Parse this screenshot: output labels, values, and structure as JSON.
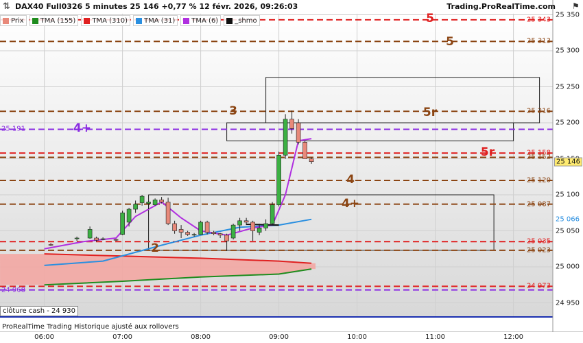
{
  "header": {
    "instrument": "DAX40 Full0326 5 minutes 25 146 +0,77 % 12 févr. 2026, 09:26:03",
    "brand": "Trading.ProRealTime.com"
  },
  "legend": [
    {
      "label": "Prix",
      "color": "#e8897a"
    },
    {
      "label": "TMA (155)",
      "color": "#1e8c1e"
    },
    {
      "label": "TMA (310)",
      "color": "#e02020"
    },
    {
      "label": "TMA (31)",
      "color": "#2a8fe0"
    },
    {
      "label": "TMA (6)",
      "color": "#b030e0"
    },
    {
      "label": "_shmo",
      "color": "#111111"
    }
  ],
  "footer": {
    "cash_close": "clôture cash -  24 930",
    "notice": "ProRealTime Trading  Historique ajusté aux rollovers"
  },
  "chart_data": {
    "type": "candlestick",
    "title": "DAX40 Full0326 5 minutes 25 146 +0,77 % 12 févr. 2026, 09:26:03",
    "x_ticks": [
      "06:00",
      "07:00",
      "08:00",
      "09:00",
      "10:00",
      "11:00",
      "12:00"
    ],
    "y_ticks": [
      "24 950",
      "25 000",
      "25 050",
      "25 100",
      "25 150",
      "25 200",
      "25 250",
      "25 300",
      "25 350"
    ],
    "ylim": [
      24915,
      25355
    ],
    "current_price": "25 146",
    "price_tags": [
      {
        "label": "25 066",
        "value": 25066,
        "color": "#2a8fe0"
      }
    ],
    "levels": [
      {
        "value": 25343,
        "label": "25 343",
        "color": "#e02020"
      },
      {
        "value": 25313,
        "label": "25 313",
        "color": "#8b4513"
      },
      {
        "value": 25216,
        "label": "25 216",
        "color": "#8b4513"
      },
      {
        "value": 25191,
        "label": "25 191",
        "color": "#8a2be2",
        "left": true
      },
      {
        "value": 25158,
        "label": "25 158",
        "color": "#e02020"
      },
      {
        "value": 25152,
        "label": "25 152",
        "color": "#8b4513"
      },
      {
        "value": 25120,
        "label": "25 120",
        "color": "#8b4513"
      },
      {
        "value": 25087,
        "label": "25 087",
        "color": "#8b4513"
      },
      {
        "value": 25035,
        "label": "25 035",
        "color": "#e02020"
      },
      {
        "value": 25023,
        "label": "25 023",
        "color": "#8b4513"
      },
      {
        "value": 24968,
        "label": "24 968",
        "color": "#8a2be2",
        "left": true
      },
      {
        "value": 24973,
        "label": "24 973",
        "color": "#e02020"
      }
    ],
    "annotations": [
      {
        "text": "5",
        "color": "#e02020"
      },
      {
        "text": "5",
        "color": "#8b4513"
      },
      {
        "text": "3",
        "color": "#8b4513"
      },
      {
        "text": "5r",
        "color": "#8b4513"
      },
      {
        "text": "4+",
        "color": "#8a2be2"
      },
      {
        "text": "5r",
        "color": "#e02020"
      },
      {
        "text": "4",
        "color": "#8b4513"
      },
      {
        "text": "4+",
        "color": "#8b4513"
      },
      {
        "text": "2",
        "color": "#8b4513"
      }
    ],
    "candles": [
      {
        "t": "06:05",
        "o": 25031,
        "h": 25033,
        "l": 25029,
        "c": 25030
      },
      {
        "t": "06:25",
        "o": 25039,
        "h": 25042,
        "l": 25036,
        "c": 25040
      },
      {
        "t": "06:35",
        "o": 25040,
        "h": 25056,
        "l": 25039,
        "c": 25052
      },
      {
        "t": "06:40",
        "o": 25040,
        "h": 25042,
        "l": 25035,
        "c": 25037
      },
      {
        "t": "06:45",
        "o": 25039,
        "h": 25041,
        "l": 25037,
        "c": 25039
      },
      {
        "t": "06:55",
        "o": 25038,
        "h": 25039,
        "l": 25036,
        "c": 25037
      },
      {
        "t": "07:00",
        "o": 25045,
        "h": 25078,
        "l": 25044,
        "c": 25075
      },
      {
        "t": "07:05",
        "o": 25062,
        "h": 25082,
        "l": 25056,
        "c": 25080
      },
      {
        "t": "07:10",
        "o": 25080,
        "h": 25092,
        "l": 25075,
        "c": 25087
      },
      {
        "t": "07:15",
        "o": 25089,
        "h": 25100,
        "l": 25085,
        "c": 25098
      },
      {
        "t": "07:20",
        "o": 25088,
        "h": 25092,
        "l": 25080,
        "c": 25090
      },
      {
        "t": "07:25",
        "o": 25086,
        "h": 25095,
        "l": 25085,
        "c": 25093
      },
      {
        "t": "07:30",
        "o": 25093,
        "h": 25097,
        "l": 25088,
        "c": 25090
      },
      {
        "t": "07:35",
        "o": 25090,
        "h": 25096,
        "l": 25058,
        "c": 25060
      },
      {
        "t": "07:40",
        "o": 25060,
        "h": 25064,
        "l": 25046,
        "c": 25050
      },
      {
        "t": "07:45",
        "o": 25052,
        "h": 25058,
        "l": 25040,
        "c": 25048
      },
      {
        "t": "07:50",
        "o": 25048,
        "h": 25050,
        "l": 25043,
        "c": 25045
      },
      {
        "t": "07:55",
        "o": 25045,
        "h": 25047,
        "l": 25042,
        "c": 25045
      },
      {
        "t": "08:00",
        "o": 25045,
        "h": 25064,
        "l": 25045,
        "c": 25062
      },
      {
        "t": "08:05",
        "o": 25062,
        "h": 25064,
        "l": 25045,
        "c": 25048
      },
      {
        "t": "08:10",
        "o": 25048,
        "h": 25050,
        "l": 25044,
        "c": 25046
      },
      {
        "t": "08:15",
        "o": 25046,
        "h": 25047,
        "l": 25040,
        "c": 25044
      },
      {
        "t": "08:20",
        "o": 25044,
        "h": 25046,
        "l": 25022,
        "c": 25036
      },
      {
        "t": "08:25",
        "o": 25040,
        "h": 25060,
        "l": 25038,
        "c": 25058
      },
      {
        "t": "08:30",
        "o": 25058,
        "h": 25068,
        "l": 25050,
        "c": 25064
      },
      {
        "t": "08:35",
        "o": 25064,
        "h": 25068,
        "l": 25058,
        "c": 25062
      },
      {
        "t": "08:40",
        "o": 25062,
        "h": 25064,
        "l": 25036,
        "c": 25050
      },
      {
        "t": "08:45",
        "o": 25048,
        "h": 25060,
        "l": 25044,
        "c": 25054
      },
      {
        "t": "08:50",
        "o": 25054,
        "h": 25066,
        "l": 25050,
        "c": 25060
      },
      {
        "t": "08:55",
        "o": 25060,
        "h": 25090,
        "l": 25058,
        "c": 25086
      },
      {
        "t": "09:00",
        "o": 25086,
        "h": 25160,
        "l": 25084,
        "c": 25155
      },
      {
        "t": "09:05",
        "o": 25155,
        "h": 25212,
        "l": 25150,
        "c": 25205
      },
      {
        "t": "09:10",
        "o": 25205,
        "h": 25217,
        "l": 25185,
        "c": 25192
      },
      {
        "t": "09:15",
        "o": 25200,
        "h": 25205,
        "l": 25170,
        "c": 25173
      },
      {
        "t": "09:20",
        "o": 25173,
        "h": 25175,
        "l": 25150,
        "c": 25150
      },
      {
        "t": "09:25",
        "o": 25150,
        "h": 25152,
        "l": 25143,
        "c": 25146
      }
    ],
    "boxes": [
      {
        "x_from": "08:50",
        "x_to": "12:20",
        "y_from": 25200,
        "y_to": 25263
      },
      {
        "x_from": "08:20",
        "x_to": "12:00",
        "y_from": 25175,
        "y_to": 25200
      },
      {
        "x_from": "07:20",
        "x_to": "11:45",
        "y_from": 25023,
        "y_to": 25100
      }
    ],
    "series": [
      {
        "name": "TMA (155)",
        "color": "#1e8c1e",
        "points": [
          [
            "06:00",
            24975
          ],
          [
            "07:00",
            24980
          ],
          [
            "08:00",
            24986
          ],
          [
            "09:00",
            24990
          ],
          [
            "09:25",
            24997
          ]
        ]
      },
      {
        "name": "TMA (310)",
        "color": "#e02020",
        "points": [
          [
            "06:00",
            25018
          ],
          [
            "07:00",
            25015
          ],
          [
            "08:00",
            25012
          ],
          [
            "09:00",
            25008
          ],
          [
            "09:25",
            25005
          ]
        ]
      },
      {
        "name": "TMA (31)",
        "color": "#2a8fe0",
        "points": [
          [
            "06:00",
            25002
          ],
          [
            "06:45",
            25008
          ],
          [
            "07:30",
            25030
          ],
          [
            "08:00",
            25044
          ],
          [
            "08:30",
            25055
          ],
          [
            "09:00",
            25058
          ],
          [
            "09:25",
            25066
          ]
        ]
      },
      {
        "name": "TMA (6)",
        "color": "#b030e0",
        "points": [
          [
            "06:00",
            25025
          ],
          [
            "06:30",
            25035
          ],
          [
            "06:55",
            25040
          ],
          [
            "07:10",
            25070
          ],
          [
            "07:30",
            25090
          ],
          [
            "07:45",
            25068
          ],
          [
            "08:00",
            25050
          ],
          [
            "08:20",
            25044
          ],
          [
            "08:40",
            25054
          ],
          [
            "08:55",
            25058
          ],
          [
            "09:05",
            25100
          ],
          [
            "09:15",
            25175
          ],
          [
            "09:25",
            25178
          ]
        ]
      }
    ]
  }
}
